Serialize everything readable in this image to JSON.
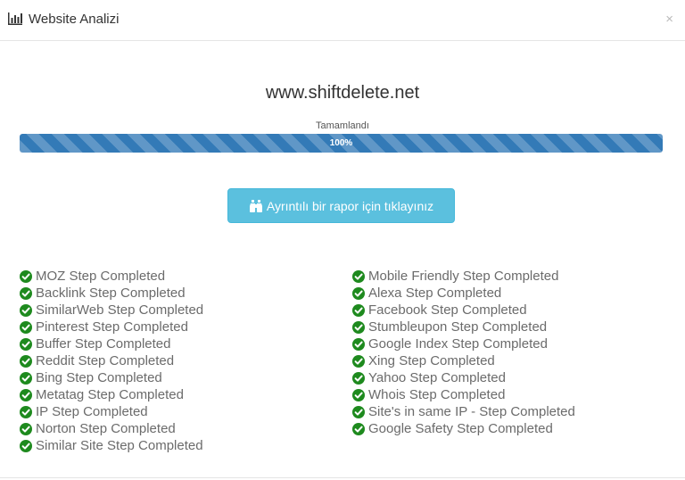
{
  "modal": {
    "title": "Website Analizi",
    "close_label": "×"
  },
  "site": {
    "name": "www.shiftdelete.net"
  },
  "progress": {
    "label": "Tamamlandı",
    "value_text": "100%",
    "value": 100,
    "color": "#337ab7"
  },
  "report_button": {
    "label": "Ayrıntılı bir rapor için tıklayınız",
    "color": "#5bc0de"
  },
  "check_color": "#1e8a1e",
  "steps_left": [
    "MOZ Step Completed",
    "Backlink Step Completed",
    "SimilarWeb Step Completed",
    "Pinterest Step Completed",
    "Buffer Step Completed",
    "Reddit Step Completed",
    "Bing Step Completed",
    "Metatag Step Completed",
    "IP Step Completed",
    "Norton Step Completed",
    "Similar Site Step Completed"
  ],
  "steps_right": [
    "Mobile Friendly Step Completed",
    "Alexa Step Completed",
    "Facebook Step Completed",
    "Stumbleupon Step Completed",
    "Google Index Step Completed",
    "Xing Step Completed",
    "Yahoo Step Completed",
    "Whois Step Completed",
    "Site's in same IP - Step Completed",
    "Google Safety Step Completed"
  ]
}
